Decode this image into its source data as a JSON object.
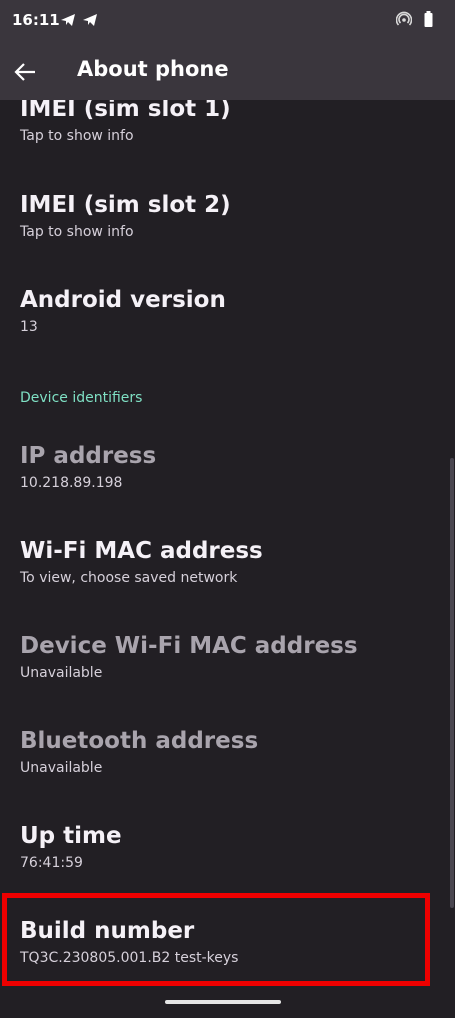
{
  "status_bar": {
    "time": "16:11"
  },
  "header": {
    "title": "About phone"
  },
  "items": [
    {
      "title": "IMEI (sim slot 1)",
      "subtitle": "Tap to show info"
    },
    {
      "title": "IMEI (sim slot 2)",
      "subtitle": "Tap to show info"
    },
    {
      "title": "Android version",
      "subtitle": "13"
    },
    {
      "title": "IP address",
      "subtitle": "10.218.89.198"
    },
    {
      "title": "Wi-Fi MAC address",
      "subtitle": "To view, choose saved network"
    },
    {
      "title": "Device Wi-Fi MAC address",
      "subtitle": "Unavailable"
    },
    {
      "title": "Bluetooth address",
      "subtitle": "Unavailable"
    },
    {
      "title": "Up time",
      "subtitle": "76:41:59"
    },
    {
      "title": "Build number",
      "subtitle": "TQ3C.230805.001.B2 test-keys"
    }
  ],
  "section": {
    "device_identifiers": "Device identifiers"
  },
  "colors": {
    "background": "#221f24",
    "app_bar": "#3a363d",
    "accent": "#7fe0c4",
    "highlight": "#ee0000"
  }
}
